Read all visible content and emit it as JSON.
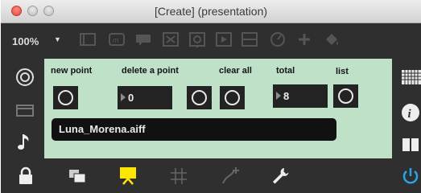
{
  "window": {
    "title": "[Create] (presentation)"
  },
  "toolbar": {
    "zoom": "100%",
    "zoom_caret": "▼",
    "icons": [
      "new-object-icon",
      "message-box-icon",
      "comment-icon",
      "toggle-icon",
      "button-icon",
      "play-icon",
      "slider-icon",
      "dial-icon",
      "add-icon",
      "paint-bucket-icon"
    ]
  },
  "left_sidebar": {
    "icons": [
      "target-icon",
      "layout-icon",
      "music-note-icon"
    ]
  },
  "right_sidebar": {
    "icons": [
      "grid-icon",
      "info-icon",
      "columns-icon",
      "power-icon"
    ]
  },
  "patch": {
    "background": "#bfe1c7",
    "labels": {
      "new_point": "new point",
      "delete_point": "delete a point",
      "clear_all": "clear all",
      "total": "total",
      "list": "list"
    },
    "delete_number": "0",
    "total_number": "8",
    "filename": "Luna_Morena.aiff"
  },
  "bottombar": {
    "icons": [
      "lock-icon",
      "windows-icon",
      "presentation-icon",
      "grid-icon",
      "patch-cord-icon",
      "wrench-icon"
    ],
    "active_color": "#ffe600"
  },
  "colors": {
    "accent_power": "#2aa4e8",
    "chrome": "#2f2f2f"
  }
}
